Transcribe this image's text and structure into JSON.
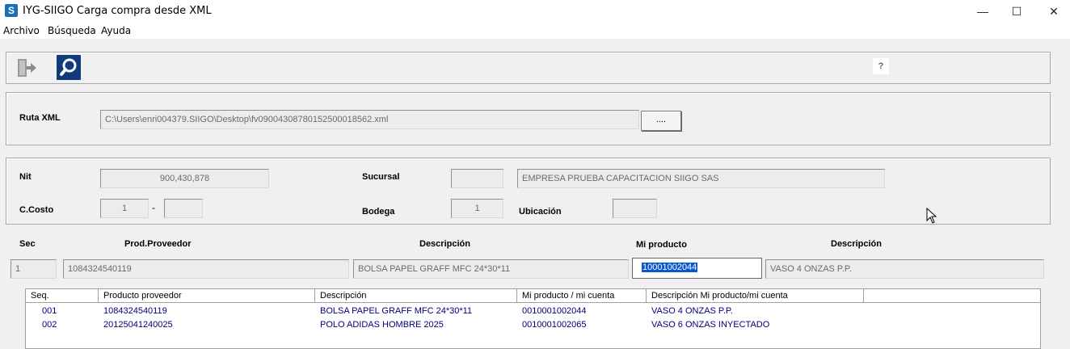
{
  "window": {
    "title": "IYG-SIIGO Carga compra desde XML",
    "app_icon_letter": "S",
    "minimize_glyph": "—",
    "maximize_glyph": "☐",
    "close_glyph": "✕"
  },
  "menu": [
    "Archivo",
    "Búsqueda",
    "Ayuda"
  ],
  "toolbar": {
    "help_label": "?"
  },
  "xml": {
    "label": "Ruta XML",
    "path": "C:\\Users\\enri004379.SIIGO\\Desktop\\fv09004308780152500018562.xml",
    "browse_label": "...."
  },
  "header": {
    "nit_label": "Nit",
    "nit_value": "900,430,878",
    "sucursal_label": "Sucursal",
    "sucursal_code": "",
    "company_name": "EMPRESA PRUEBA CAPACITACION SIIGO SAS",
    "ccosto_label": "C.Costo",
    "ccosto_value": "1",
    "ccosto_separator": "-",
    "ccosto_sub": "",
    "bodega_label": "Bodega",
    "bodega_value": "1",
    "ubicacion_label": "Ubicación",
    "ubicacion_value": ""
  },
  "detail": {
    "sec_label": "Sec",
    "prod_proveedor_label": "Prod.Proveedor",
    "descripcion_label": "Descripción",
    "mi_producto_label": "Mi producto",
    "descripcion2_label": "Descripción",
    "sec_value": "1",
    "prod_proveedor_value": "1084324540119",
    "descripcion_value": "BOLSA PAPEL GRAFF MFC 24*30*11",
    "mi_producto_value": "10001002044",
    "descripcion2_value": "VASO 4 ONZAS P.P."
  },
  "grid": {
    "headers": [
      "Seq.",
      "Producto proveedor",
      "Descripción",
      "Mi producto / mi cuenta",
      "Descripción Mi producto/mi cuenta",
      ""
    ],
    "rows": [
      [
        "001",
        "1084324540119",
        "BOLSA PAPEL GRAFF MFC 24*30*11",
        "0010001002044",
        "VASO 4 ONZAS P.P."
      ],
      [
        "002",
        "20125041240025",
        "POLO ADIDAS HOMBRE 2025",
        "0010001002065",
        "VASO 6 ONZAS INYECTADO"
      ]
    ]
  }
}
